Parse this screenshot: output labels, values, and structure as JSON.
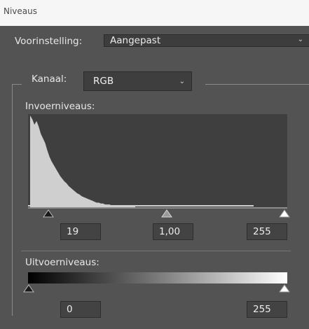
{
  "window": {
    "title": "Niveaus"
  },
  "preset": {
    "label": "Voorinstelling:",
    "value": "Aangepast",
    "chevron_icon": "chevron-down-icon"
  },
  "channel": {
    "label": "Kanaal:",
    "value": "RGB",
    "chevron_icon": "chevron-down-icon"
  },
  "input_levels": {
    "label": "Invoerniveaus:",
    "shadow": "19",
    "gamma": "1,00",
    "highlight": "255",
    "histogram": [
      100,
      96,
      90,
      94,
      88,
      80,
      75,
      70,
      62,
      55,
      50,
      46,
      42,
      38,
      34,
      31,
      28,
      26,
      23,
      21,
      19,
      17,
      15,
      14,
      12,
      11,
      10,
      9,
      8,
      7,
      6,
      5,
      5,
      4,
      4,
      3,
      3,
      3,
      2,
      2,
      2,
      2,
      2,
      1,
      1,
      1,
      1,
      1,
      1,
      1
    ]
  },
  "output_levels": {
    "label": "Uitvoerniveaus:",
    "black": "0",
    "white": "255"
  },
  "colors": {
    "dialog": "#535353",
    "histogram_bg": "#3f3f3f",
    "histogram_fill": "#cfcfcf"
  }
}
